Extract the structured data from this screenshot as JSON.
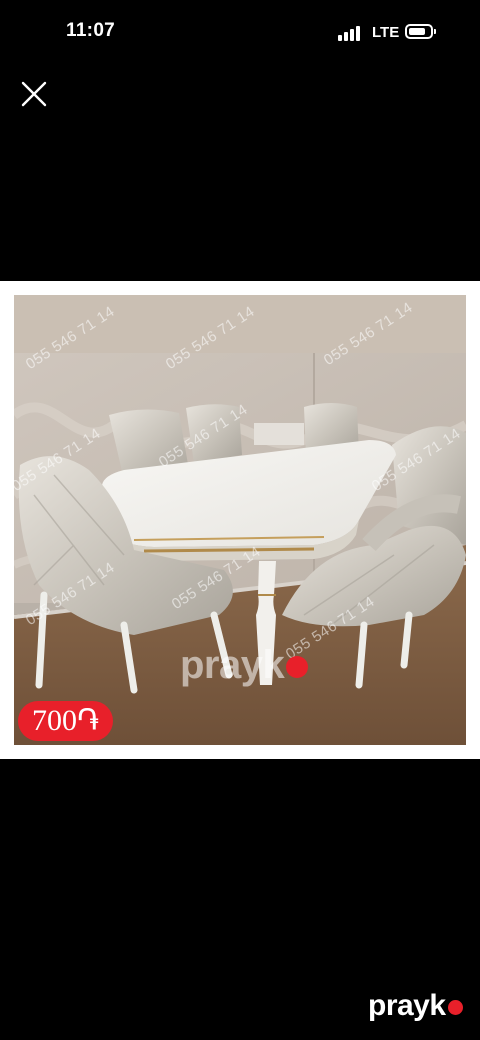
{
  "status_bar": {
    "time": "11:07",
    "network": "LTE",
    "signal_icon": "signal-bars-icon",
    "battery_icon": "battery-icon"
  },
  "viewer": {
    "close_icon": "close-icon",
    "price": "700֏",
    "watermark_phone": "055 546 71 14",
    "brand": "prayk",
    "accent_color": "#e8202a",
    "background_color": "#000000"
  }
}
